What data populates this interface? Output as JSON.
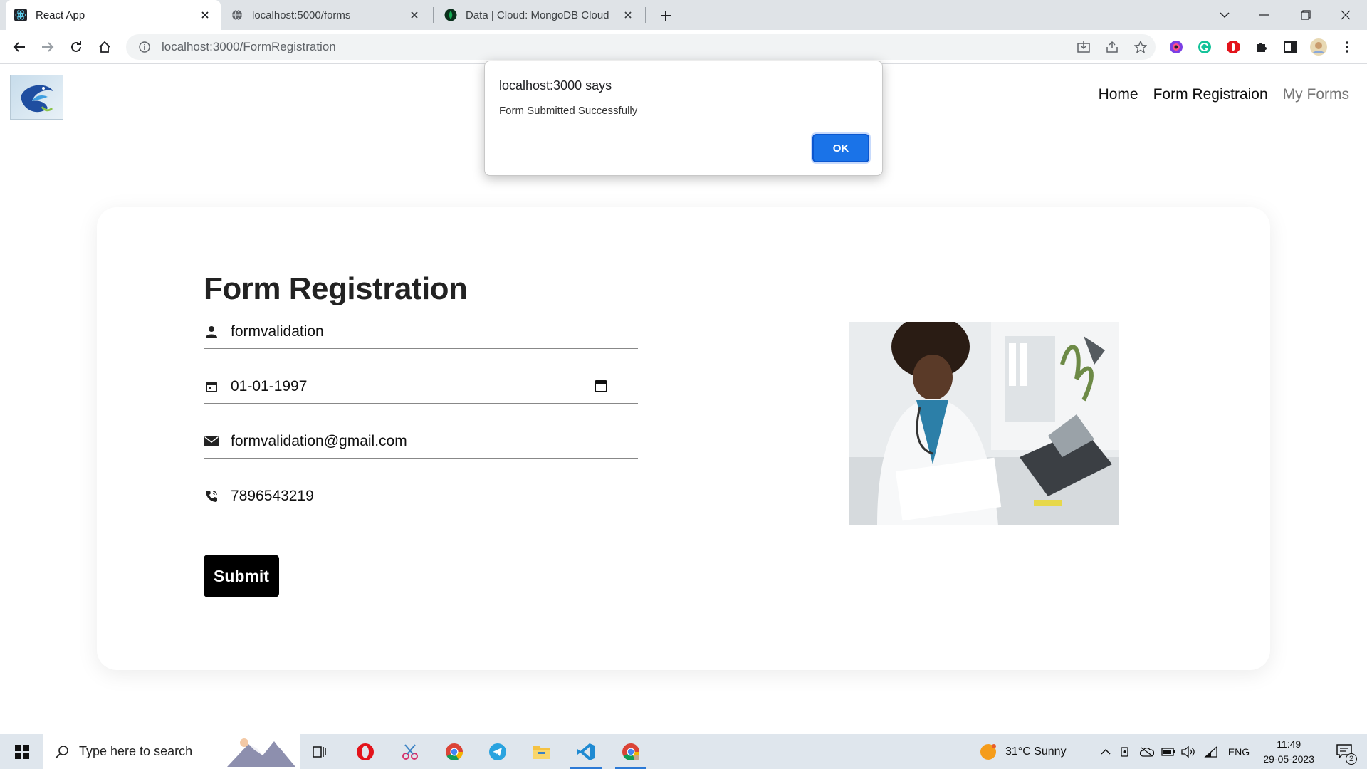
{
  "browser": {
    "tabs": [
      {
        "title": "React App",
        "icon": "react-icon",
        "active": true
      },
      {
        "title": "localhost:5000/forms",
        "icon": "globe-icon",
        "active": false
      },
      {
        "title": "Data | Cloud: MongoDB Cloud",
        "icon": "mongodb-leaf-icon",
        "active": false
      }
    ],
    "url": "localhost:3000/FormRegistration"
  },
  "nav": {
    "home": "Home",
    "form_registration": "Form Registraion",
    "my_forms": "My Forms"
  },
  "form": {
    "title": "Form Registration",
    "name_value": "formvalidation",
    "dob_value": "01-01-1997",
    "email_value": "formvalidation@gmail.com",
    "phone_value": "7896543219",
    "submit_label": "Submit"
  },
  "dialog": {
    "title": "localhost:3000 says",
    "message": "Form Submitted Successfully",
    "ok_label": "OK"
  },
  "taskbar": {
    "search_placeholder": "Type here to search",
    "weather": "31°C  Sunny",
    "lang": "ENG",
    "time": "11:49",
    "date": "29-05-2023",
    "notifications": "2"
  },
  "colors": {
    "accent_blue": "#1a73e8",
    "submit_bg": "#000000",
    "nav_muted": "#777777"
  }
}
